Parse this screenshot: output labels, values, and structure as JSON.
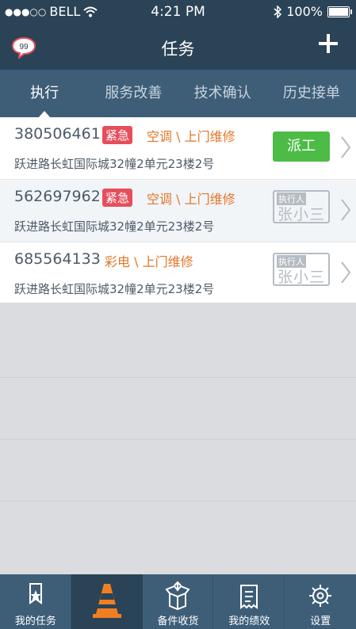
{
  "status": {
    "carrier": "BELL",
    "time": "4:21 PM",
    "battery": "100%"
  },
  "nav": {
    "title": "任务",
    "badge_count": "99"
  },
  "tabs": [
    {
      "label": "执行",
      "active": true
    },
    {
      "label": "服务改善"
    },
    {
      "label": "技术确认"
    },
    {
      "label": "历史接单"
    }
  ],
  "tasks": [
    {
      "number": "380506461",
      "urgent": "紧急",
      "category": "空调 \\ 上门维修",
      "address": "跃进路长虹国际城32幢2单元23楼2号",
      "action": "派工"
    },
    {
      "number": "562697962",
      "urgent": "紧急",
      "category": "空调 \\ 上门维修",
      "address": "跃进路长虹国际城32幢2单元23楼2号",
      "executor_label": "执行人",
      "executor": "张小三"
    },
    {
      "number": "685564133",
      "category": "彩电 \\ 上门维修",
      "address": "跃进路长虹国际城32幢2单元23楼2号",
      "executor_label": "执行人",
      "executor": "张小三"
    }
  ],
  "tabbar": [
    {
      "label": "我的任务",
      "icon": "bookmark-star-icon"
    },
    {
      "label": "",
      "icon": "traffic-cone-icon",
      "active": true
    },
    {
      "label": "备件收货",
      "icon": "package-icon"
    },
    {
      "label": "我的绩效",
      "icon": "receipt-icon"
    },
    {
      "label": "设置",
      "icon": "gear-icon"
    }
  ],
  "colors": {
    "header": "#2b4356",
    "tab_bg": "#3e5e78",
    "urgent": "#e74e5c",
    "category": "#e1772a",
    "dispatch": "#4cbc46"
  }
}
